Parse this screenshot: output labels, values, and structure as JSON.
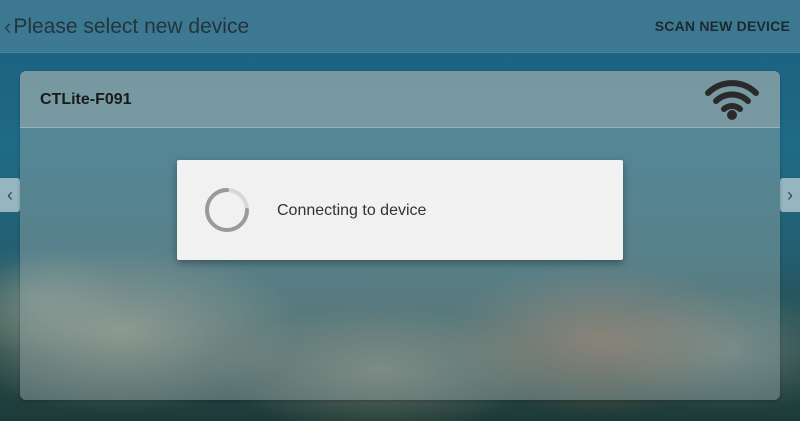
{
  "header": {
    "back_icon": "chevron-left-icon",
    "title": "Please select new device",
    "scan_button_label": "SCAN NEW DEVICE"
  },
  "device_card": {
    "device_name": "CTLite-F091",
    "signal_icon": "wifi-icon"
  },
  "carousel": {
    "prev_icon": "chevron-left-icon",
    "next_icon": "chevron-right-icon"
  },
  "dialog": {
    "message": "Connecting to device",
    "spinner_icon": "loading-spinner-icon"
  },
  "colors": {
    "dialog_background": "#f1f1f1",
    "text_dark": "#1a1a1a"
  }
}
